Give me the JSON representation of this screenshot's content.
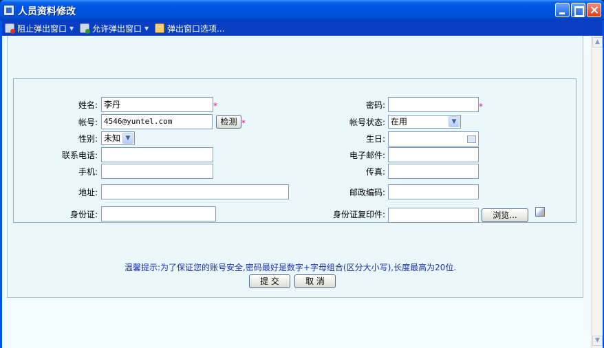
{
  "window": {
    "title": "人员资料修改"
  },
  "popup_bar": {
    "block_label": "阻止弹出窗口",
    "allow_label": "允许弹出窗口",
    "options_label": "弹出窗口选项..."
  },
  "form": {
    "name_label": "姓名:",
    "name_value": "李丹",
    "password_label": "密码:",
    "password_value": "",
    "account_label": "帐号:",
    "account_value": "4546@yuntel.com",
    "check_button": "检测",
    "account_status_label": "帐号状态:",
    "account_status_value": "在用",
    "gender_label": "性别:",
    "gender_value": "未知",
    "birthday_label": "生日:",
    "birthday_value": "",
    "phone_label": "联系电话:",
    "phone_value": "",
    "email_label": "电子邮件:",
    "email_value": "",
    "mobile_label": "手机:",
    "mobile_value": "",
    "fax_label": "传真:",
    "fax_value": "",
    "address_label": "地址:",
    "address_value": "",
    "postcode_label": "邮政编码:",
    "postcode_value": "",
    "id_label": "身份证:",
    "id_value": "",
    "id_copy_label": "身份证复印件:",
    "id_copy_value": "",
    "browse_button": "浏览...",
    "required_mark": "*"
  },
  "footer": {
    "tip": "温馨提示:为了保证您的账号安全,密码最好是数字+字母组合(区分大小写),长度最高为20位.",
    "submit_button": "提 交",
    "cancel_button": "取 消"
  },
  "colors": {
    "titlebar": "#0054e3",
    "panel_bg": "#eaf8fc",
    "tip_text": "#1a2fa8",
    "required": "#e0109a"
  }
}
